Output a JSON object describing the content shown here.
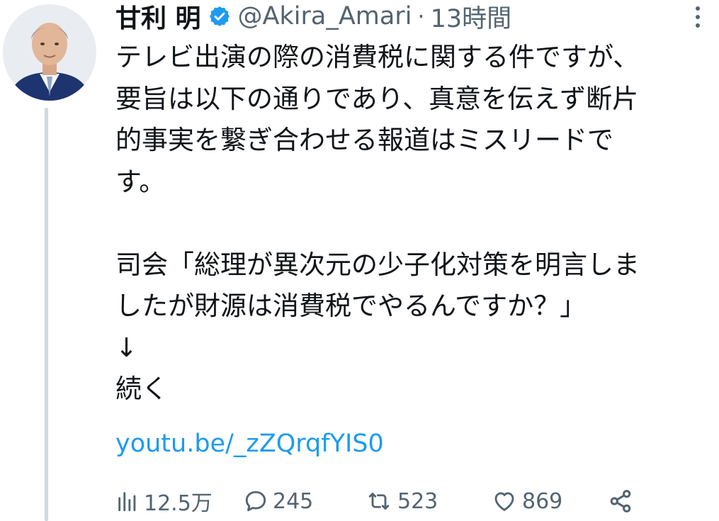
{
  "author": {
    "name": "甘利 明",
    "handle": "@Akira_Amari",
    "separator": "·",
    "time": "13時間",
    "verified_color": "#1d9bf0"
  },
  "tweet": {
    "lines": [
      "テレビ出演の際の消費税に関する件ですが、",
      "要旨は以下の通りであり、真意を伝えず断片",
      "的事実を繋ぎ合わせる報道はミスリードで",
      "す。",
      "",
      "司会「総理が異次元の少子化対策を明言しま",
      "したが財源は消費税でやるんですか？」",
      "↓",
      "続く"
    ],
    "link": "youtu.be/_zZQrqfYIS0"
  },
  "actions": {
    "views": "12.5万",
    "replies": "245",
    "retweets": "523",
    "likes": "869"
  },
  "icons": [
    "more-icon",
    "views-icon",
    "reply-icon",
    "retweet-icon",
    "like-icon",
    "share-icon",
    "verified-badge-icon"
  ]
}
